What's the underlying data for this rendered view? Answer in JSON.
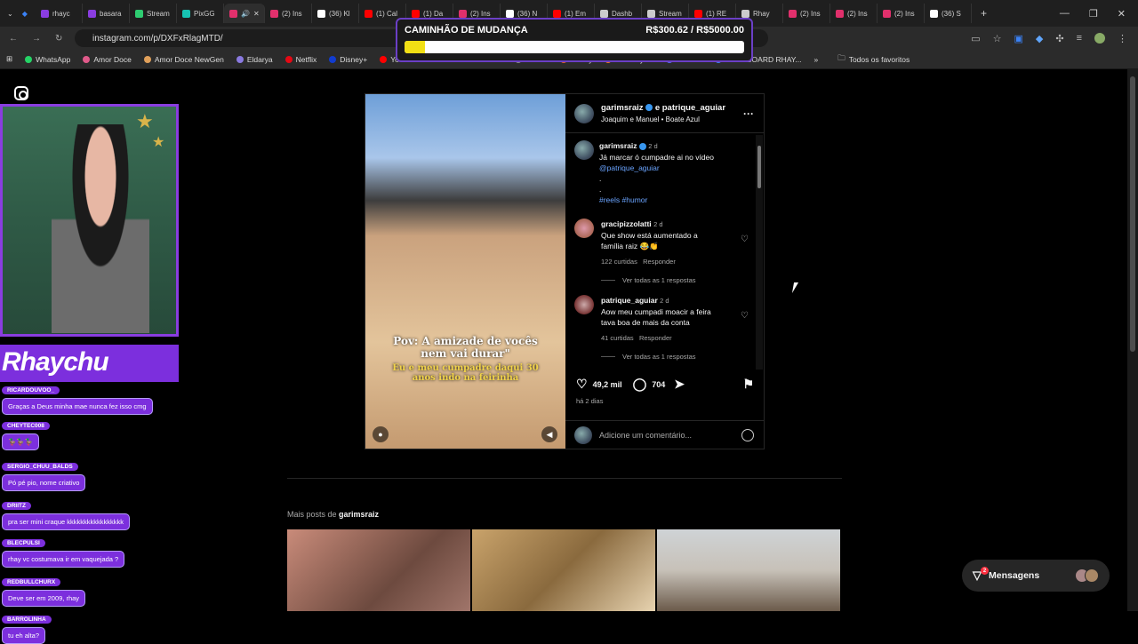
{
  "browser": {
    "tabs": [
      {
        "label": "rhayc",
        "color": "#8a3de0"
      },
      {
        "label": "basara",
        "color": "#8a3de0"
      },
      {
        "label": "Stream",
        "color": "#2ecc71"
      },
      {
        "label": "PixGG",
        "color": "#17c3b2"
      },
      {
        "label": "",
        "color": "#e1306c",
        "active": true
      },
      {
        "label": "(2) Ins",
        "color": "#e1306c"
      },
      {
        "label": "(36) Kl",
        "color": "#ffffff"
      },
      {
        "label": "(1) Cal",
        "color": "#ff0000"
      },
      {
        "label": "(1) Da",
        "color": "#ff0000"
      },
      {
        "label": "(2) Ins",
        "color": "#e1306c"
      },
      {
        "label": "(36) N",
        "color": "#ffffff"
      },
      {
        "label": "(1) Em",
        "color": "#ff0000"
      },
      {
        "label": "Dashb",
        "color": "#cccccc"
      },
      {
        "label": "Stream",
        "color": "#cccccc"
      },
      {
        "label": "(1) RE",
        "color": "#ff0000"
      },
      {
        "label": "Rhay",
        "color": "#cccccc"
      },
      {
        "label": "(2) Ins",
        "color": "#e1306c"
      },
      {
        "label": "(2) Ins",
        "color": "#e1306c"
      },
      {
        "label": "(2) Ins",
        "color": "#e1306c"
      },
      {
        "label": "(36) S",
        "color": "#ffffff"
      }
    ],
    "new_tab": "+",
    "url": "instagram.com/p/DXFxRlagMTD/",
    "bookmarks": [
      {
        "label": "WhatsApp",
        "color": "#25d366"
      },
      {
        "label": "Amor Doce",
        "color": "#e05a8a"
      },
      {
        "label": "Amor Doce NewGen",
        "color": "#e0a05a"
      },
      {
        "label": "Eldarya",
        "color": "#8a7ae0"
      },
      {
        "label": "Netflix",
        "color": "#e50914"
      },
      {
        "label": "Disney+",
        "color": "#113ccf"
      },
      {
        "label": "Yo",
        "color": "#ff0000"
      }
    ],
    "bookmarks_right": [
      {
        "label": "Center",
        "color": "#888888"
      },
      {
        "label": "Cinefy",
        "color": "#e05a2a"
      },
      {
        "label": "Crunchyroll",
        "color": "#f47521"
      },
      {
        "label": "Discord",
        "color": "#5865f2"
      },
      {
        "label": "DASHBOARD RHAY...",
        "color": "#3b82f6"
      }
    ],
    "favorites_label": "Todos os favoritos"
  },
  "overlay": {
    "title": "CAMINHÃO DE MUDANÇA",
    "amount": "R$300.62 / R$5000.00",
    "progress": 0.06
  },
  "stream": {
    "brand": "Rhaychu",
    "chat": [
      {
        "user": "RICARDOUVOO_",
        "text": "Graças a Deus minha mae nunca fez isso cmg"
      },
      {
        "user": "CHEYTEC008",
        "text": "🦆🦆🦆"
      },
      {
        "user": "SERGIO_CHUU_BALDS",
        "text": "Pó pé pio, nome criativo"
      },
      {
        "user": "DRIITZ",
        "text": "pra ser mini craque kkkkkkkkkkkkkkkkk"
      },
      {
        "user": "BLECPULSI",
        "text": "rhay vc costumava ir em vaquejada ?"
      },
      {
        "user": "REDBULLCHURX",
        "text": "Deve ser em 2009, rhay"
      },
      {
        "user": "BARROLINHA",
        "text": "tu eh alta?"
      }
    ]
  },
  "post": {
    "header_user": "garimsraiz",
    "header_and": " e ",
    "header_collab": "patrique_aguiar",
    "header_sub1": "Joaquim e Manuel",
    "header_sub2": "Boate Azul",
    "video_caption_1": "Pov: A amizade de vocês nem vai durar\"",
    "video_caption_2": "Eu e meu cumpadre daqui 30 anos indo na feirinha",
    "caption": {
      "user": "garimsraiz",
      "time": "2 d",
      "text": "Já marcar ó cumpadre ai no vídeo",
      "mention": "@patrique_aguiar",
      "dot1": ".",
      "dot2": ".",
      "tags": "#reels #humor"
    },
    "comments": [
      {
        "user": "gracipizzolatti",
        "time": "2 d",
        "line1": "Que show está aumentado a",
        "line2": "família raiz 😂👏",
        "likes": "122 curtidas",
        "reply": "Responder",
        "view": "Ver todas as 1 respostas"
      },
      {
        "user": "patrique_aguiar",
        "time": "2 d",
        "line1": "Aow meu cumpadi moacir a feira",
        "line2": "tava boa de mais da conta",
        "likes": "41 curtidas",
        "reply": "Responder",
        "view": "Ver todas as 1 respostas"
      }
    ],
    "likes": "49,2 mil",
    "comment_count": "704",
    "ago": "há 2 dias",
    "add_comment": "Adicione um comentário..."
  },
  "more_posts": {
    "prefix": "Mais posts de ",
    "user": "garimsraiz"
  },
  "messages": {
    "label": "Mensagens",
    "badge": "2"
  }
}
